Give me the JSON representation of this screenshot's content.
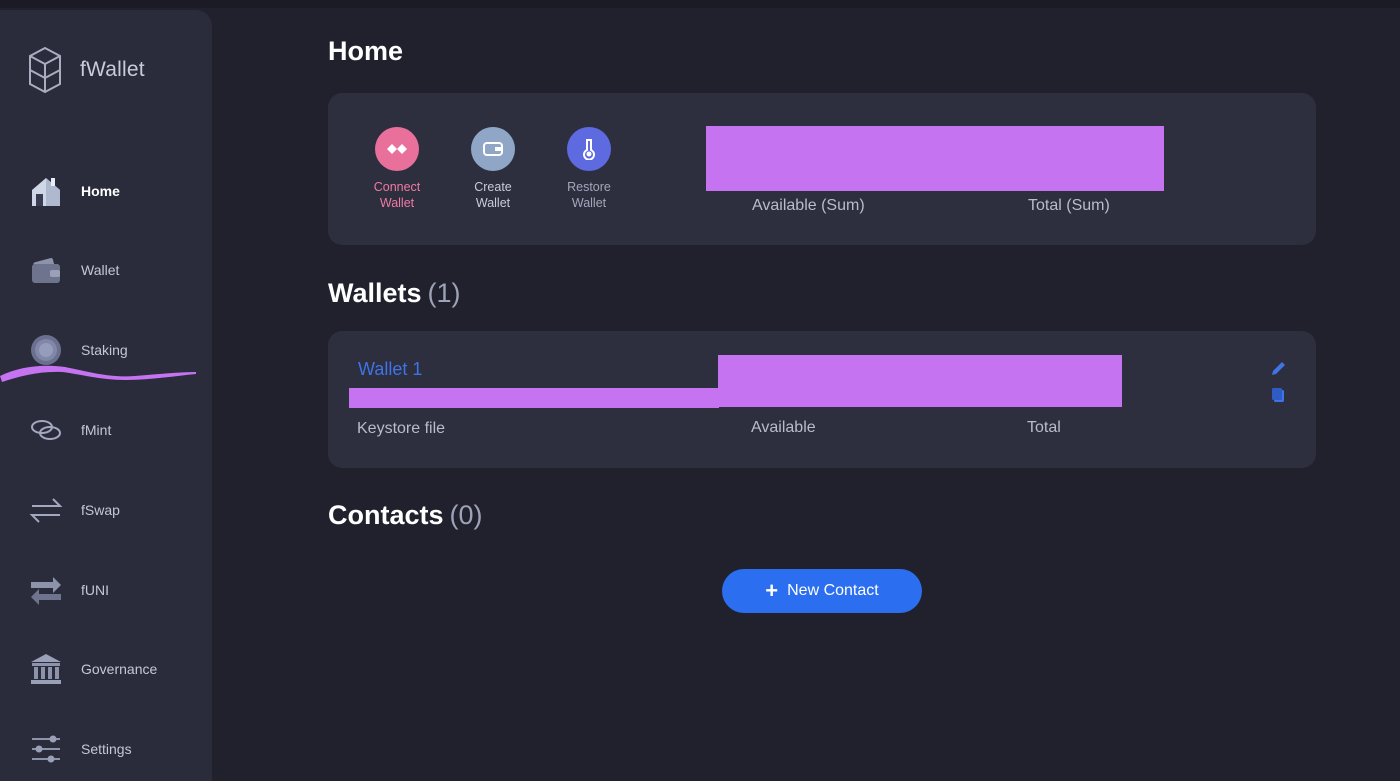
{
  "app": {
    "name": "fWallet"
  },
  "sidebar": {
    "items": [
      {
        "label": "Home",
        "icon": "home-icon",
        "active": true
      },
      {
        "label": "Wallet",
        "icon": "wallet-icon"
      },
      {
        "label": "Staking",
        "icon": "staking-icon"
      },
      {
        "label": "fMint",
        "icon": "fmint-icon"
      },
      {
        "label": "fSwap",
        "icon": "fswap-icon"
      },
      {
        "label": "fUNI",
        "icon": "funi-icon"
      },
      {
        "label": "Governance",
        "icon": "governance-icon"
      },
      {
        "label": "Settings",
        "icon": "settings-icon"
      }
    ]
  },
  "main": {
    "title": "Home",
    "actions": [
      {
        "line1": "Connect",
        "line2": "Wallet",
        "color": "#e8709a",
        "text_color": "#f07aa3"
      },
      {
        "line1": "Create",
        "line2": "Wallet",
        "color": "#8fa6c7",
        "text_color": "#c9ccd8"
      },
      {
        "line1": "Restore",
        "line2": "Wallet",
        "color": "#5d6ae0",
        "text_color": "#a3a7ba"
      }
    ],
    "summary": {
      "available_label": "Available (Sum)",
      "total_label": "Total (Sum)"
    },
    "wallets": {
      "title": "Wallets",
      "count": "(1)",
      "items": [
        {
          "name": "Wallet 1",
          "type": "Keystore file",
          "available_label": "Available",
          "total_label": "Total"
        }
      ]
    },
    "contacts": {
      "title": "Contacts",
      "count": "(0)",
      "new_button": "New Contact"
    }
  },
  "colors": {
    "background": "#20212d",
    "sidebar": "#2b2c3b",
    "card": "#2d2e3e",
    "accent": "#2b6ef0",
    "redaction": "#c673f2"
  }
}
